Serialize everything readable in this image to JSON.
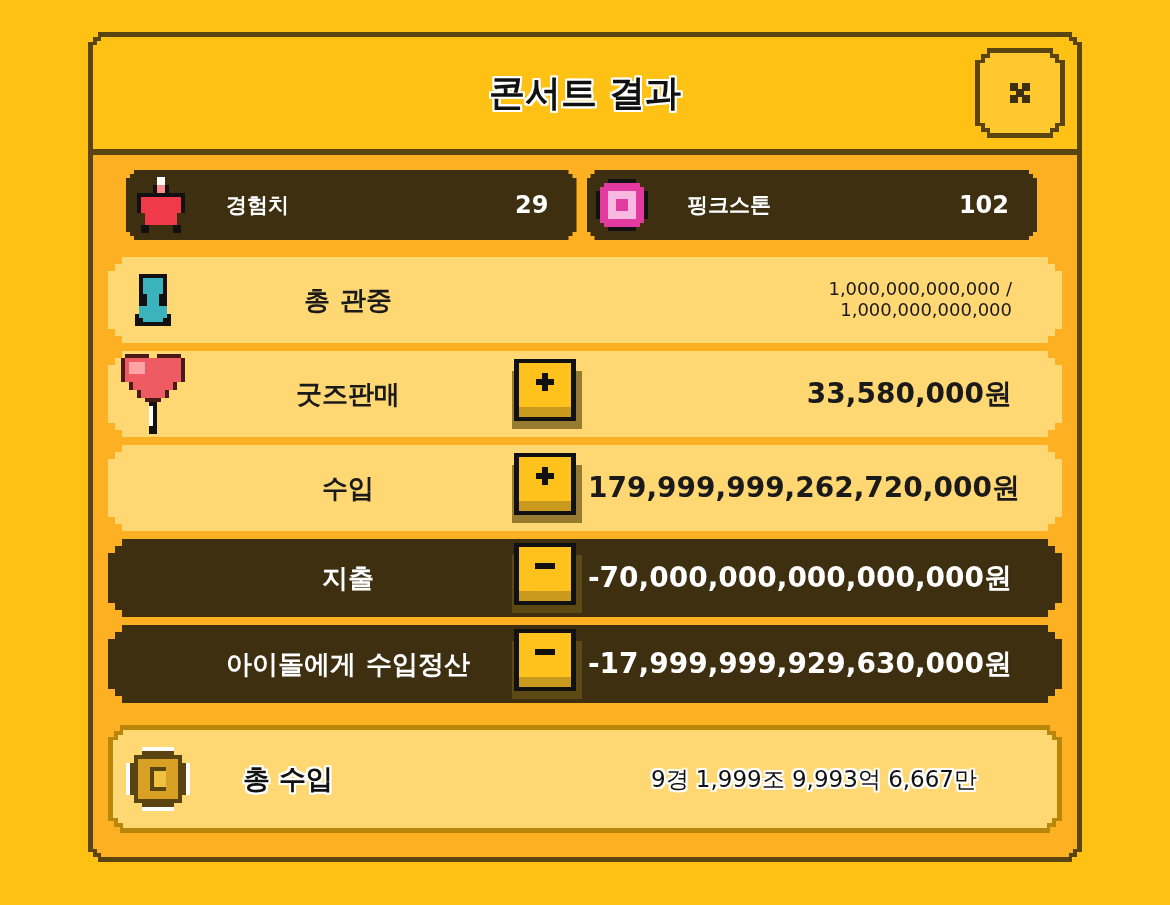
{
  "title": "콘서트 결과",
  "rewards": [
    {
      "label": "경험치",
      "value": "29"
    },
    {
      "label": "핑크스톤",
      "value": "102"
    }
  ],
  "rows": [
    {
      "kind": "info",
      "label": "총 관중",
      "value_lines": [
        "1,000,000,000,000 /",
        "1,000,000,000,000"
      ]
    },
    {
      "kind": "plus",
      "label": "굿즈판매",
      "value_lines": [
        "33,580,000원"
      ]
    },
    {
      "kind": "plus",
      "label": "수입",
      "value_lines": [
        "179,999,999,262,720,000원"
      ]
    },
    {
      "kind": "minus",
      "label": "지출",
      "value_lines": [
        "-70,000,000,000,000,000원"
      ]
    },
    {
      "kind": "minus",
      "label": "아이돌에게 수입정산",
      "value_lines": [
        "-17,999,999,929,630,000원"
      ]
    }
  ],
  "total": {
    "label": "총 수입",
    "value": "9경 1,999조 9,993억 6,667만"
  }
}
